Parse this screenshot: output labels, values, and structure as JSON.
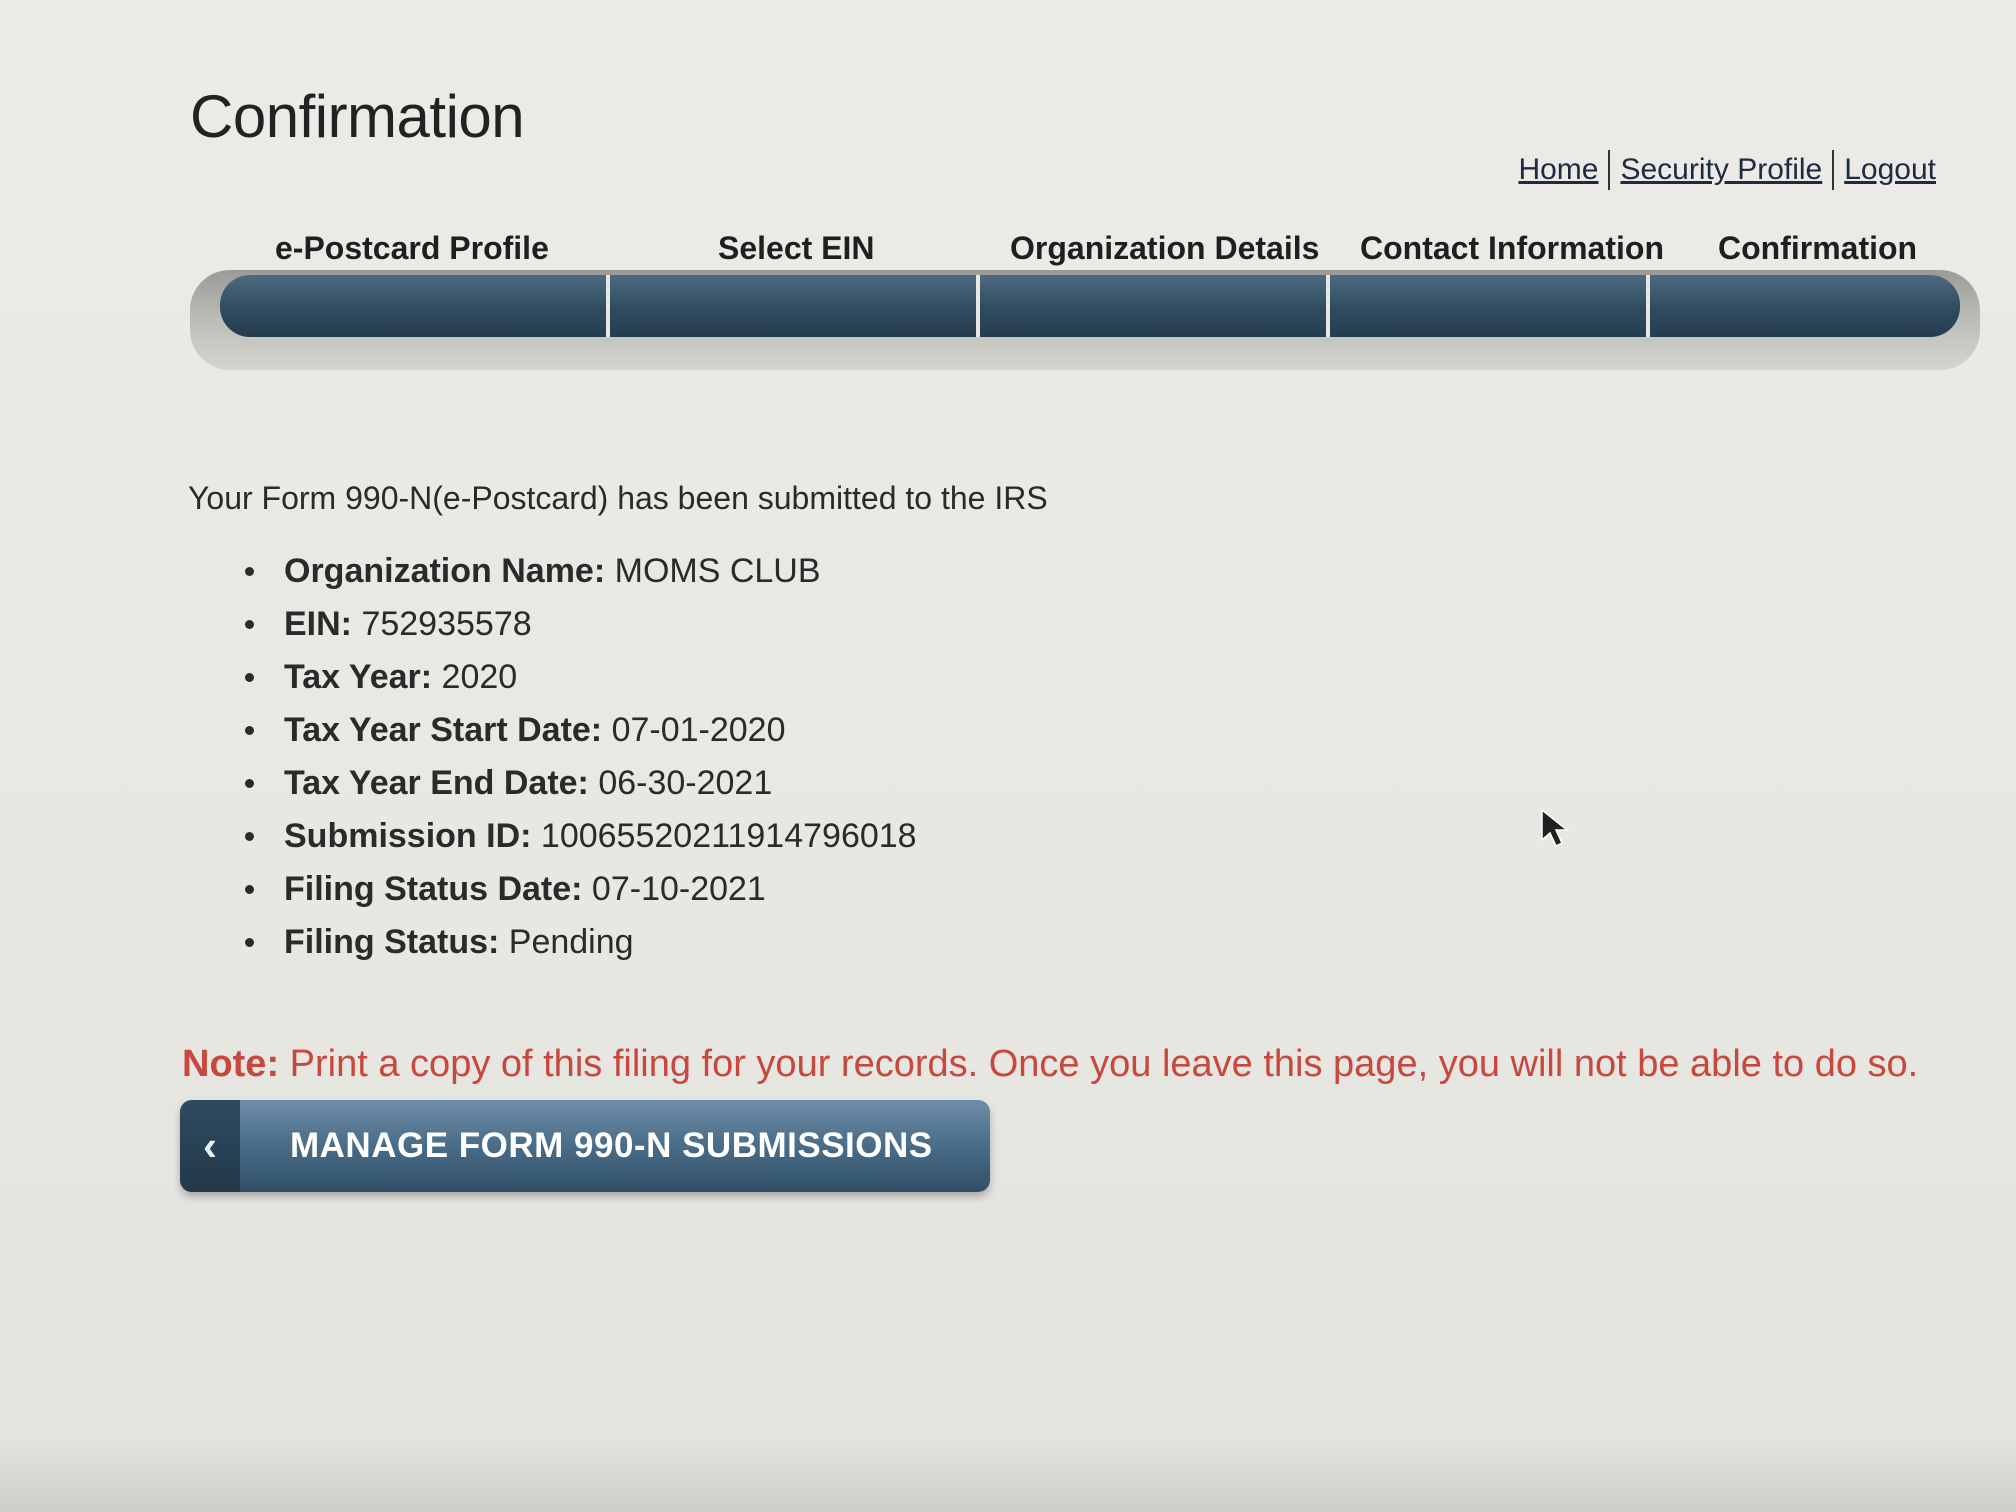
{
  "page": {
    "title": "Confirmation"
  },
  "top_links": {
    "home": "Home",
    "security_profile": "Security Profile",
    "logout": "Logout"
  },
  "progress": {
    "steps": [
      "e-Postcard Profile",
      "Select EIN",
      "Organization Details",
      "Contact Information",
      "Confirmation"
    ],
    "current_step": 5,
    "total_steps": 5
  },
  "confirmation": {
    "message": "Your Form 990-N(e-Postcard) has been submitted to the IRS",
    "fields": [
      {
        "label": "Organization Name:",
        "value": "MOMS CLUB"
      },
      {
        "label": "EIN:",
        "value": "752935578"
      },
      {
        "label": "Tax Year:",
        "value": "2020"
      },
      {
        "label": "Tax Year Start Date:",
        "value": "07-01-2020"
      },
      {
        "label": "Tax Year End Date:",
        "value": "06-30-2021"
      },
      {
        "label": "Submission ID:",
        "value": "10065520211914796018"
      },
      {
        "label": "Filing Status Date:",
        "value": "07-10-2021"
      },
      {
        "label": "Filing Status:",
        "value": "Pending"
      }
    ]
  },
  "note": {
    "label": "Note:",
    "text": "Print a copy of this filing for your records. Once you leave this page, you will not be able to do so."
  },
  "actions": {
    "manage_button": "MANAGE FORM 990-N SUBMISSIONS",
    "manage_icon": "chevron-left-icon",
    "manage_glyph": "‹"
  },
  "colors": {
    "note_red": "#c8473f",
    "progress_blue": "#2f4b60",
    "button_blue": "#4d6f8a"
  }
}
